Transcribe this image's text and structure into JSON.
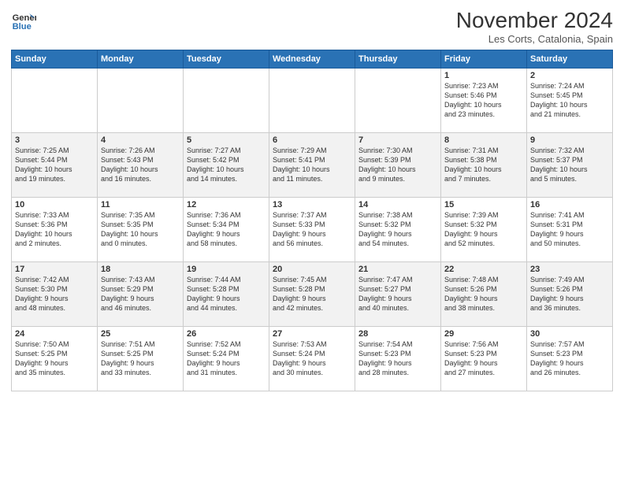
{
  "logo": {
    "text_line1": "General",
    "text_line2": "Blue"
  },
  "header": {
    "month": "November 2024",
    "location": "Les Corts, Catalonia, Spain"
  },
  "weekdays": [
    "Sunday",
    "Monday",
    "Tuesday",
    "Wednesday",
    "Thursday",
    "Friday",
    "Saturday"
  ],
  "weeks": [
    [
      {
        "day": "",
        "info": ""
      },
      {
        "day": "",
        "info": ""
      },
      {
        "day": "",
        "info": ""
      },
      {
        "day": "",
        "info": ""
      },
      {
        "day": "",
        "info": ""
      },
      {
        "day": "1",
        "info": "Sunrise: 7:23 AM\nSunset: 5:46 PM\nDaylight: 10 hours\nand 23 minutes."
      },
      {
        "day": "2",
        "info": "Sunrise: 7:24 AM\nSunset: 5:45 PM\nDaylight: 10 hours\nand 21 minutes."
      }
    ],
    [
      {
        "day": "3",
        "info": "Sunrise: 7:25 AM\nSunset: 5:44 PM\nDaylight: 10 hours\nand 19 minutes."
      },
      {
        "day": "4",
        "info": "Sunrise: 7:26 AM\nSunset: 5:43 PM\nDaylight: 10 hours\nand 16 minutes."
      },
      {
        "day": "5",
        "info": "Sunrise: 7:27 AM\nSunset: 5:42 PM\nDaylight: 10 hours\nand 14 minutes."
      },
      {
        "day": "6",
        "info": "Sunrise: 7:29 AM\nSunset: 5:41 PM\nDaylight: 10 hours\nand 11 minutes."
      },
      {
        "day": "7",
        "info": "Sunrise: 7:30 AM\nSunset: 5:39 PM\nDaylight: 10 hours\nand 9 minutes."
      },
      {
        "day": "8",
        "info": "Sunrise: 7:31 AM\nSunset: 5:38 PM\nDaylight: 10 hours\nand 7 minutes."
      },
      {
        "day": "9",
        "info": "Sunrise: 7:32 AM\nSunset: 5:37 PM\nDaylight: 10 hours\nand 5 minutes."
      }
    ],
    [
      {
        "day": "10",
        "info": "Sunrise: 7:33 AM\nSunset: 5:36 PM\nDaylight: 10 hours\nand 2 minutes."
      },
      {
        "day": "11",
        "info": "Sunrise: 7:35 AM\nSunset: 5:35 PM\nDaylight: 10 hours\nand 0 minutes."
      },
      {
        "day": "12",
        "info": "Sunrise: 7:36 AM\nSunset: 5:34 PM\nDaylight: 9 hours\nand 58 minutes."
      },
      {
        "day": "13",
        "info": "Sunrise: 7:37 AM\nSunset: 5:33 PM\nDaylight: 9 hours\nand 56 minutes."
      },
      {
        "day": "14",
        "info": "Sunrise: 7:38 AM\nSunset: 5:32 PM\nDaylight: 9 hours\nand 54 minutes."
      },
      {
        "day": "15",
        "info": "Sunrise: 7:39 AM\nSunset: 5:32 PM\nDaylight: 9 hours\nand 52 minutes."
      },
      {
        "day": "16",
        "info": "Sunrise: 7:41 AM\nSunset: 5:31 PM\nDaylight: 9 hours\nand 50 minutes."
      }
    ],
    [
      {
        "day": "17",
        "info": "Sunrise: 7:42 AM\nSunset: 5:30 PM\nDaylight: 9 hours\nand 48 minutes."
      },
      {
        "day": "18",
        "info": "Sunrise: 7:43 AM\nSunset: 5:29 PM\nDaylight: 9 hours\nand 46 minutes."
      },
      {
        "day": "19",
        "info": "Sunrise: 7:44 AM\nSunset: 5:28 PM\nDaylight: 9 hours\nand 44 minutes."
      },
      {
        "day": "20",
        "info": "Sunrise: 7:45 AM\nSunset: 5:28 PM\nDaylight: 9 hours\nand 42 minutes."
      },
      {
        "day": "21",
        "info": "Sunrise: 7:47 AM\nSunset: 5:27 PM\nDaylight: 9 hours\nand 40 minutes."
      },
      {
        "day": "22",
        "info": "Sunrise: 7:48 AM\nSunset: 5:26 PM\nDaylight: 9 hours\nand 38 minutes."
      },
      {
        "day": "23",
        "info": "Sunrise: 7:49 AM\nSunset: 5:26 PM\nDaylight: 9 hours\nand 36 minutes."
      }
    ],
    [
      {
        "day": "24",
        "info": "Sunrise: 7:50 AM\nSunset: 5:25 PM\nDaylight: 9 hours\nand 35 minutes."
      },
      {
        "day": "25",
        "info": "Sunrise: 7:51 AM\nSunset: 5:25 PM\nDaylight: 9 hours\nand 33 minutes."
      },
      {
        "day": "26",
        "info": "Sunrise: 7:52 AM\nSunset: 5:24 PM\nDaylight: 9 hours\nand 31 minutes."
      },
      {
        "day": "27",
        "info": "Sunrise: 7:53 AM\nSunset: 5:24 PM\nDaylight: 9 hours\nand 30 minutes."
      },
      {
        "day": "28",
        "info": "Sunrise: 7:54 AM\nSunset: 5:23 PM\nDaylight: 9 hours\nand 28 minutes."
      },
      {
        "day": "29",
        "info": "Sunrise: 7:56 AM\nSunset: 5:23 PM\nDaylight: 9 hours\nand 27 minutes."
      },
      {
        "day": "30",
        "info": "Sunrise: 7:57 AM\nSunset: 5:23 PM\nDaylight: 9 hours\nand 26 minutes."
      }
    ]
  ]
}
